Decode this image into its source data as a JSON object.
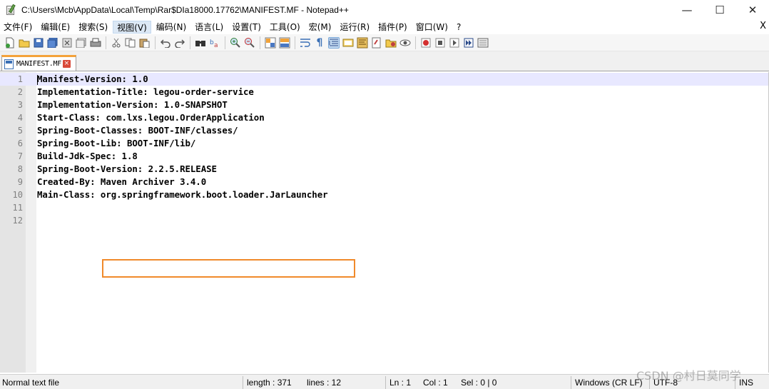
{
  "window": {
    "title": "C:\\Users\\Mcb\\AppData\\Local\\Temp\\Rar$DIa18000.17762\\MANIFEST.MF - Notepad++",
    "minimize": "—",
    "maximize": "☐",
    "close": "✕"
  },
  "menu": {
    "items": [
      "文件(F)",
      "编辑(E)",
      "搜索(S)",
      "视图(V)",
      "编码(N)",
      "语言(L)",
      "设置(T)",
      "工具(O)",
      "宏(M)",
      "运行(R)",
      "插件(P)",
      "窗口(W)",
      "?"
    ],
    "active_index": 3,
    "close_label": "X"
  },
  "toolbar": {
    "icons": [
      "new-file-icon",
      "open-file-icon",
      "save-icon",
      "save-all-icon",
      "close-icon",
      "close-all-icon",
      "print-icon",
      "cut-icon",
      "copy-icon",
      "paste-icon",
      "undo-icon",
      "redo-icon",
      "find-icon",
      "replace-icon",
      "zoom-in-icon",
      "zoom-out-icon",
      "sync-vertical-icon",
      "sync-horizontal-icon",
      "word-wrap-icon",
      "show-all-chars-icon",
      "indent-guide-icon",
      "user-language-icon",
      "doc-map-icon",
      "function-list-icon",
      "folder-workspace-icon",
      "monitoring-icon",
      "record-macro-icon",
      "stop-record-icon",
      "playback-macro-icon",
      "run-macro-multiple-icon",
      "save-macro-icon"
    ]
  },
  "tab": {
    "label": "MANIFEST.MF",
    "close": "×"
  },
  "editor": {
    "lines": [
      {
        "num": "1",
        "text": "Manifest-Version: 1.0"
      },
      {
        "num": "2",
        "text": "Implementation-Title: legou-order-service"
      },
      {
        "num": "3",
        "text": "Implementation-Version: 1.0-SNAPSHOT"
      },
      {
        "num": "4",
        "text": "Start-Class: com.lxs.legou.OrderApplication"
      },
      {
        "num": "5",
        "text": "Spring-Boot-Classes: BOOT-INF/classes/"
      },
      {
        "num": "6",
        "text": "Spring-Boot-Lib: BOOT-INF/lib/"
      },
      {
        "num": "7",
        "text": "Build-Jdk-Spec: 1.8"
      },
      {
        "num": "8",
        "text": "Spring-Boot-Version: 2.2.5.RELEASE"
      },
      {
        "num": "9",
        "text": "Created-By: Maven Archiver 3.4.0"
      },
      {
        "num": "10",
        "text": "Main-Class: org.springframework.boot.loader.JarLauncher"
      },
      {
        "num": "11",
        "text": ""
      },
      {
        "num": "12",
        "text": ""
      }
    ],
    "current_line": 1,
    "highlight_color": "#f08a2b"
  },
  "status": {
    "file_type": "Normal text file",
    "length": "length : 371",
    "lines": "lines : 12",
    "ln": "Ln : 1",
    "col": "Col : 1",
    "sel": "Sel : 0 | 0",
    "eol": "Windows (CR LF)",
    "encoding": "UTF-8",
    "mode": "INS"
  },
  "watermark": "CSDN @村日莫同学"
}
